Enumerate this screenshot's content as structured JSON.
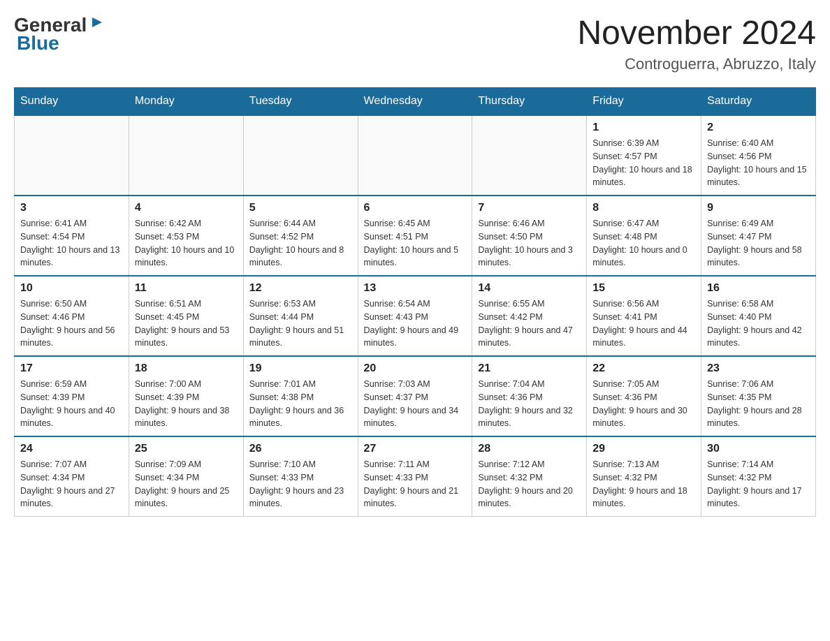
{
  "header": {
    "logo_general": "General",
    "logo_blue": "Blue",
    "month_year": "November 2024",
    "location": "Controguerra, Abruzzo, Italy"
  },
  "days_of_week": [
    "Sunday",
    "Monday",
    "Tuesday",
    "Wednesday",
    "Thursday",
    "Friday",
    "Saturday"
  ],
  "weeks": [
    [
      {
        "day": "",
        "info": ""
      },
      {
        "day": "",
        "info": ""
      },
      {
        "day": "",
        "info": ""
      },
      {
        "day": "",
        "info": ""
      },
      {
        "day": "",
        "info": ""
      },
      {
        "day": "1",
        "info": "Sunrise: 6:39 AM\nSunset: 4:57 PM\nDaylight: 10 hours and 18 minutes."
      },
      {
        "day": "2",
        "info": "Sunrise: 6:40 AM\nSunset: 4:56 PM\nDaylight: 10 hours and 15 minutes."
      }
    ],
    [
      {
        "day": "3",
        "info": "Sunrise: 6:41 AM\nSunset: 4:54 PM\nDaylight: 10 hours and 13 minutes."
      },
      {
        "day": "4",
        "info": "Sunrise: 6:42 AM\nSunset: 4:53 PM\nDaylight: 10 hours and 10 minutes."
      },
      {
        "day": "5",
        "info": "Sunrise: 6:44 AM\nSunset: 4:52 PM\nDaylight: 10 hours and 8 minutes."
      },
      {
        "day": "6",
        "info": "Sunrise: 6:45 AM\nSunset: 4:51 PM\nDaylight: 10 hours and 5 minutes."
      },
      {
        "day": "7",
        "info": "Sunrise: 6:46 AM\nSunset: 4:50 PM\nDaylight: 10 hours and 3 minutes."
      },
      {
        "day": "8",
        "info": "Sunrise: 6:47 AM\nSunset: 4:48 PM\nDaylight: 10 hours and 0 minutes."
      },
      {
        "day": "9",
        "info": "Sunrise: 6:49 AM\nSunset: 4:47 PM\nDaylight: 9 hours and 58 minutes."
      }
    ],
    [
      {
        "day": "10",
        "info": "Sunrise: 6:50 AM\nSunset: 4:46 PM\nDaylight: 9 hours and 56 minutes."
      },
      {
        "day": "11",
        "info": "Sunrise: 6:51 AM\nSunset: 4:45 PM\nDaylight: 9 hours and 53 minutes."
      },
      {
        "day": "12",
        "info": "Sunrise: 6:53 AM\nSunset: 4:44 PM\nDaylight: 9 hours and 51 minutes."
      },
      {
        "day": "13",
        "info": "Sunrise: 6:54 AM\nSunset: 4:43 PM\nDaylight: 9 hours and 49 minutes."
      },
      {
        "day": "14",
        "info": "Sunrise: 6:55 AM\nSunset: 4:42 PM\nDaylight: 9 hours and 47 minutes."
      },
      {
        "day": "15",
        "info": "Sunrise: 6:56 AM\nSunset: 4:41 PM\nDaylight: 9 hours and 44 minutes."
      },
      {
        "day": "16",
        "info": "Sunrise: 6:58 AM\nSunset: 4:40 PM\nDaylight: 9 hours and 42 minutes."
      }
    ],
    [
      {
        "day": "17",
        "info": "Sunrise: 6:59 AM\nSunset: 4:39 PM\nDaylight: 9 hours and 40 minutes."
      },
      {
        "day": "18",
        "info": "Sunrise: 7:00 AM\nSunset: 4:39 PM\nDaylight: 9 hours and 38 minutes."
      },
      {
        "day": "19",
        "info": "Sunrise: 7:01 AM\nSunset: 4:38 PM\nDaylight: 9 hours and 36 minutes."
      },
      {
        "day": "20",
        "info": "Sunrise: 7:03 AM\nSunset: 4:37 PM\nDaylight: 9 hours and 34 minutes."
      },
      {
        "day": "21",
        "info": "Sunrise: 7:04 AM\nSunset: 4:36 PM\nDaylight: 9 hours and 32 minutes."
      },
      {
        "day": "22",
        "info": "Sunrise: 7:05 AM\nSunset: 4:36 PM\nDaylight: 9 hours and 30 minutes."
      },
      {
        "day": "23",
        "info": "Sunrise: 7:06 AM\nSunset: 4:35 PM\nDaylight: 9 hours and 28 minutes."
      }
    ],
    [
      {
        "day": "24",
        "info": "Sunrise: 7:07 AM\nSunset: 4:34 PM\nDaylight: 9 hours and 27 minutes."
      },
      {
        "day": "25",
        "info": "Sunrise: 7:09 AM\nSunset: 4:34 PM\nDaylight: 9 hours and 25 minutes."
      },
      {
        "day": "26",
        "info": "Sunrise: 7:10 AM\nSunset: 4:33 PM\nDaylight: 9 hours and 23 minutes."
      },
      {
        "day": "27",
        "info": "Sunrise: 7:11 AM\nSunset: 4:33 PM\nDaylight: 9 hours and 21 minutes."
      },
      {
        "day": "28",
        "info": "Sunrise: 7:12 AM\nSunset: 4:32 PM\nDaylight: 9 hours and 20 minutes."
      },
      {
        "day": "29",
        "info": "Sunrise: 7:13 AM\nSunset: 4:32 PM\nDaylight: 9 hours and 18 minutes."
      },
      {
        "day": "30",
        "info": "Sunrise: 7:14 AM\nSunset: 4:32 PM\nDaylight: 9 hours and 17 minutes."
      }
    ]
  ]
}
